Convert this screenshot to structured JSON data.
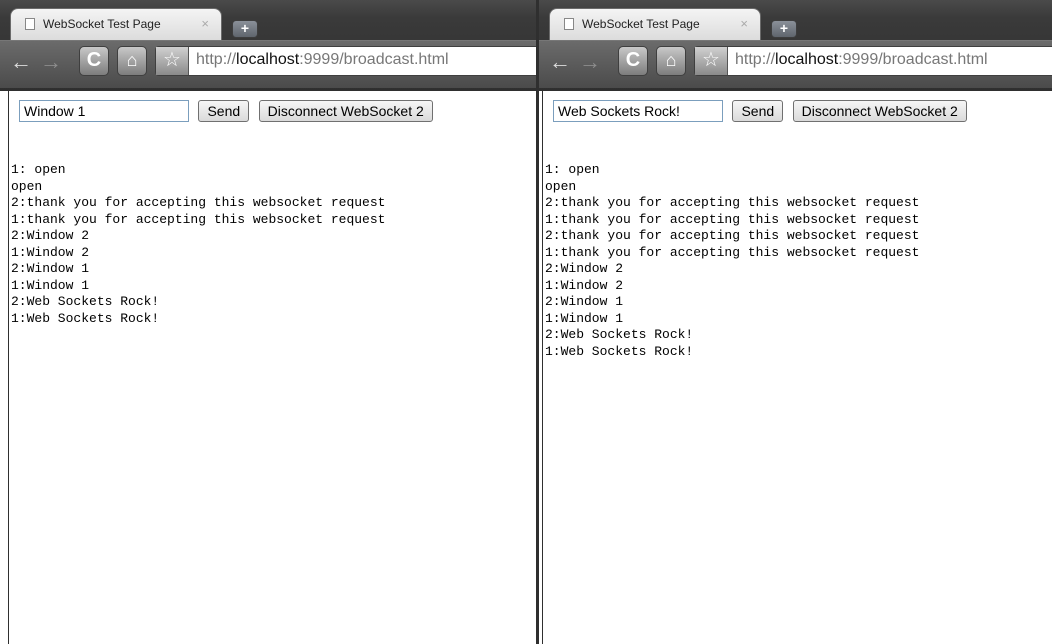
{
  "windows": [
    {
      "tab": {
        "title": "WebSocket Test Page",
        "close": "×",
        "newtab": "+"
      },
      "toolbar": {
        "back": "←",
        "forward": "→",
        "reload": "C",
        "home": "⌂",
        "star": "☆",
        "url_prefix": "http://",
        "url_host": "localhost",
        "url_rest": ":9999/broadcast.html"
      },
      "page": {
        "input_value": "Window 1",
        "send_label": "Send",
        "disconnect_label": "Disconnect WebSocket 2",
        "log": [
          "1: open",
          "open",
          "2:thank you for accepting this websocket request",
          "1:thank you for accepting this websocket request",
          "2:Window 2",
          "1:Window 2",
          "2:Window 1",
          "1:Window 1",
          "2:Web Sockets Rock!",
          "1:Web Sockets Rock!"
        ]
      }
    },
    {
      "tab": {
        "title": "WebSocket Test Page",
        "close": "×",
        "newtab": "+"
      },
      "toolbar": {
        "back": "←",
        "forward": "→",
        "reload": "C",
        "home": "⌂",
        "star": "☆",
        "url_prefix": "http://",
        "url_host": "localhost",
        "url_rest": ":9999/broadcast.html"
      },
      "page": {
        "input_value": "Web Sockets Rock!",
        "send_label": "Send",
        "disconnect_label": "Disconnect WebSocket 2",
        "log": [
          "1: open",
          "open",
          "2:thank you for accepting this websocket request",
          "1:thank you for accepting this websocket request",
          "2:thank you for accepting this websocket request",
          "1:thank you for accepting this websocket request",
          "2:Window 2",
          "1:Window 2",
          "2:Window 1",
          "1:Window 1",
          "2:Web Sockets Rock!",
          "1:Web Sockets Rock!"
        ]
      }
    }
  ]
}
